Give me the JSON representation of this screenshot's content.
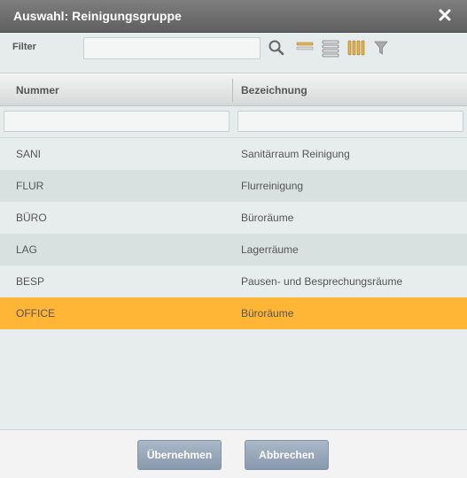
{
  "dialog": {
    "title": "Auswahl: Reinigungsgruppe",
    "close_icon": "close-icon"
  },
  "filter": {
    "label": "Filter",
    "value": "",
    "placeholder": "",
    "tools": [
      "search-icon",
      "rows-compact-icon",
      "rows-list-icon",
      "columns-icon",
      "filter-funnel-icon"
    ]
  },
  "grid": {
    "columns": [
      "Nummer",
      "Bezeichnung"
    ],
    "column_filters": [
      "",
      ""
    ],
    "rows": [
      {
        "nummer": "SANI",
        "bezeichnung": "Sanitärraum Reinigung"
      },
      {
        "nummer": "FLUR",
        "bezeichnung": "Flurreinigung"
      },
      {
        "nummer": "BÜRO",
        "bezeichnung": "Büroräume"
      },
      {
        "nummer": "LAG",
        "bezeichnung": "Lagerräume"
      },
      {
        "nummer": "BESP",
        "bezeichnung": "Pausen- und Besprechungsräume"
      },
      {
        "nummer": "OFFICE",
        "bezeichnung": "Büroräume"
      }
    ],
    "selected_row": "OFFICE"
  },
  "buttons": {
    "accept": "Übernehmen",
    "cancel": "Abbrechen"
  },
  "colors": {
    "selection": "#ffb536",
    "titlebar": "#6e6e6e",
    "button": "#97a8ba"
  }
}
